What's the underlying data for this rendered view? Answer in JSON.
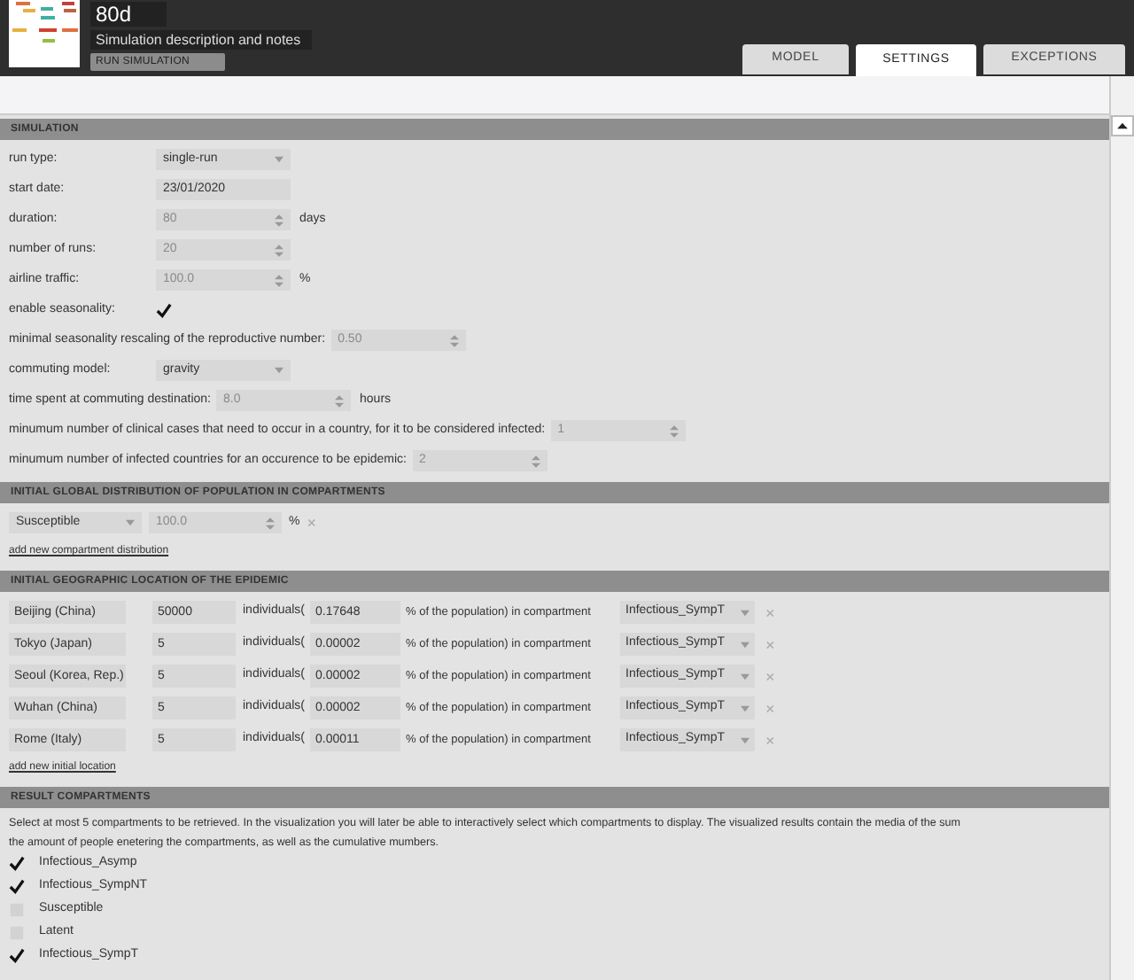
{
  "header": {
    "title": "80d",
    "description": "Simulation description and notes",
    "run_button": "RUN SIMULATION"
  },
  "tabs": [
    {
      "label": "MODEL",
      "selected": false
    },
    {
      "label": "SETTINGS",
      "selected": true
    },
    {
      "label": "EXCEPTIONS",
      "selected": false
    }
  ],
  "simulation": {
    "title": "SIMULATION",
    "fields": [
      {
        "kind": "select",
        "label": "run type:",
        "value": "single-run"
      },
      {
        "kind": "text",
        "label": "start date:",
        "value": "23/01/2020"
      },
      {
        "kind": "spinner",
        "label": "duration:",
        "value": "80",
        "unit": "days"
      },
      {
        "kind": "spinner",
        "label": "number of runs:",
        "value": "20"
      },
      {
        "kind": "spinner",
        "label": "airline traffic:",
        "value": "100.0",
        "unit": "%"
      },
      {
        "kind": "checkbox",
        "label": "enable seasonality:",
        "checked": true
      },
      {
        "kind": "spinner",
        "label": "minimal seasonality rescaling of the reproductive number:",
        "value": "0.50"
      },
      {
        "kind": "select",
        "label": "commuting model:",
        "value": "gravity"
      },
      {
        "kind": "spinner",
        "label": "time spent at commuting destination:",
        "value": "8.0",
        "unit": "hours"
      },
      {
        "kind": "spinner",
        "label": "minumum number of clinical cases that need to occur in a country, for it to be considered infected:",
        "value": "1"
      },
      {
        "kind": "spinner",
        "label": "minumum number of infected countries for an occurence to be epidemic:",
        "value": "2"
      }
    ]
  },
  "distribution": {
    "title": "INITIAL GLOBAL DISTRIBUTION OF POPULATION IN COMPARTMENTS",
    "rows": [
      {
        "compartment": "Susceptible",
        "value": "100.0",
        "unit": "%",
        "remove": "×"
      }
    ],
    "add_link": "add new compartment distribution"
  },
  "locations": {
    "title": "INITIAL GEOGRAPHIC LOCATION OF THE EPIDEMIC",
    "rows": [
      {
        "place": "Beijing (China)",
        "count": "50000",
        "individuals": "individuals(",
        "percent": "0.17648",
        "population": "% of the population) in compartment",
        "compartment": "Infectious_SympT",
        "remove": "×"
      },
      {
        "place": "Tokyo (Japan)",
        "count": "5",
        "individuals": "individuals(",
        "percent": "0.00002",
        "population": "% of the population) in compartment",
        "compartment": "Infectious_SympT",
        "remove": "×"
      },
      {
        "place": "Seoul (Korea, Rep.)",
        "count": "5",
        "individuals": "individuals(",
        "percent": "0.00002",
        "population": "% of the population) in compartment",
        "compartment": "Infectious_SympT",
        "remove": "×"
      },
      {
        "place": "Wuhan (China)",
        "count": "5",
        "individuals": "individuals(",
        "percent": "0.00002",
        "population": "% of the population) in compartment",
        "compartment": "Infectious_SympT",
        "remove": "×"
      },
      {
        "place": "Rome (Italy)",
        "count": "5",
        "individuals": "individuals(",
        "percent": "0.00011",
        "population": "% of the population) in compartment",
        "compartment": "Infectious_SympT",
        "remove": "×"
      }
    ],
    "add_link": "add new initial location"
  },
  "results": {
    "title": "RESULT COMPARTMENTS",
    "description_lines": [
      "Select at most 5 compartments to be retrieved. In the visualization you will later be able to interactively select which compartments to display. The visualized results contain the media of the sum",
      "the amount of people enetering the compartments, as well as the cumulative mumbers."
    ],
    "compartments": [
      {
        "label": "Infectious_Asymp",
        "checked": true
      },
      {
        "label": "Infectious_SympNT",
        "checked": true
      },
      {
        "label": "Susceptible",
        "checked": false
      },
      {
        "label": "Latent",
        "checked": false
      },
      {
        "label": "Infectious_SympT",
        "checked": true
      }
    ]
  }
}
